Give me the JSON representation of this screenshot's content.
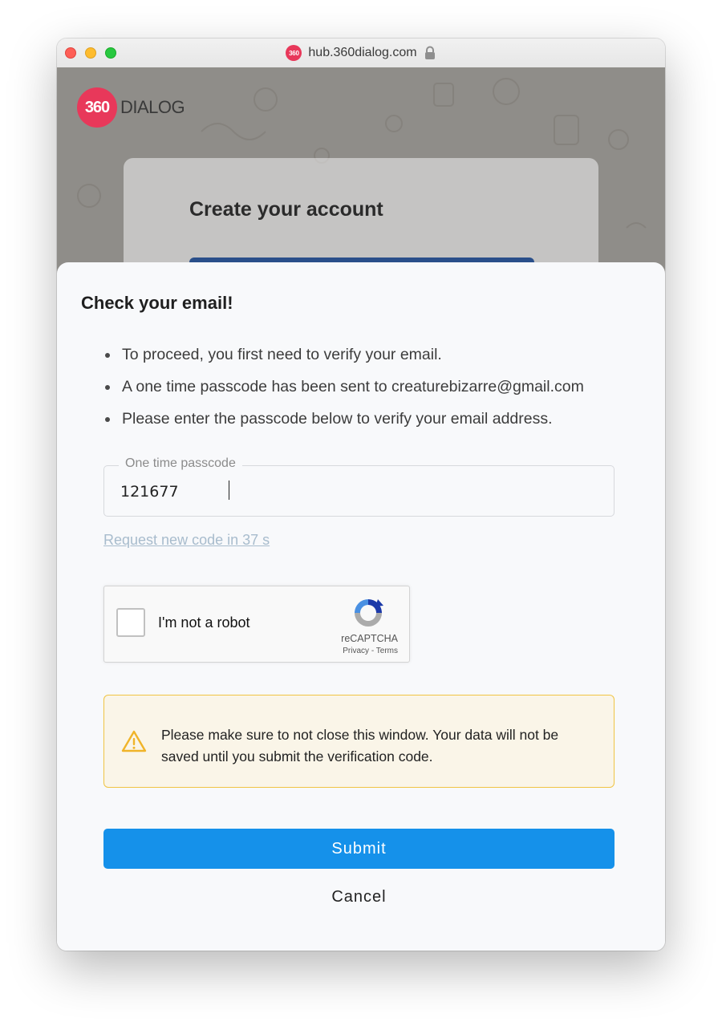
{
  "browser": {
    "favicon_text": "360",
    "url": "hub.360dialog.com",
    "lock_icon": "lock-icon"
  },
  "background_page": {
    "logo_mark": "360",
    "logo_text": "DIALOG",
    "card_title": "Create your account"
  },
  "modal": {
    "title": "Check your email!",
    "bullets": [
      "To proceed, you first need to verify your email.",
      "A one time passcode has been sent to creaturebizarre@gmail.com",
      "Please enter the passcode below to verify your email address."
    ],
    "otp": {
      "label": "One time passcode",
      "value": "121677"
    },
    "resend_link": "Request new code in 37 s",
    "captcha": {
      "label": "I'm not a robot",
      "brand": "reCAPTCHA",
      "privacy": "Privacy",
      "separator": " - ",
      "terms": "Terms",
      "checked": false
    },
    "warning": {
      "icon": "warning-icon",
      "text": "Please make sure to not close this window. Your data will not be saved until you submit the verification code."
    },
    "submit_label": "Submit",
    "cancel_label": "Cancel"
  },
  "colors": {
    "brand": "#e8385a",
    "primary_button": "#1591ea",
    "warning_border": "#f0c443",
    "warning_bg": "#faf5e8",
    "link_muted": "#a8bccd"
  }
}
